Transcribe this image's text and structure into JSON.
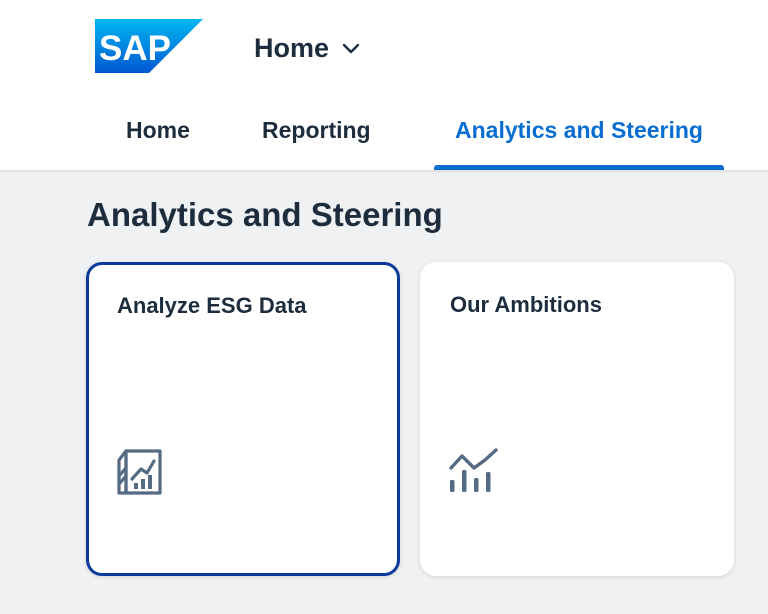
{
  "header": {
    "logo_text": "SAP",
    "app_title": "Home",
    "brand_color": "#0a6ed1"
  },
  "tabs": [
    {
      "label": "Home",
      "selected": false
    },
    {
      "label": "Reporting",
      "selected": false
    },
    {
      "label": "Analytics and Steering",
      "selected": true
    }
  ],
  "section": {
    "title": "Analytics and Steering"
  },
  "tiles": [
    {
      "title": "Analyze ESG Data",
      "icon": "analytics-report-icon",
      "focused": true
    },
    {
      "title": "Our Ambitions",
      "icon": "line-bar-chart-icon",
      "focused": false
    }
  ],
  "colors": {
    "text": "#1d2d3e",
    "accent": "#0a6ed1",
    "focus_border": "#0b3a9c",
    "page_background": "#eff1f2",
    "icon": "#556b82"
  }
}
